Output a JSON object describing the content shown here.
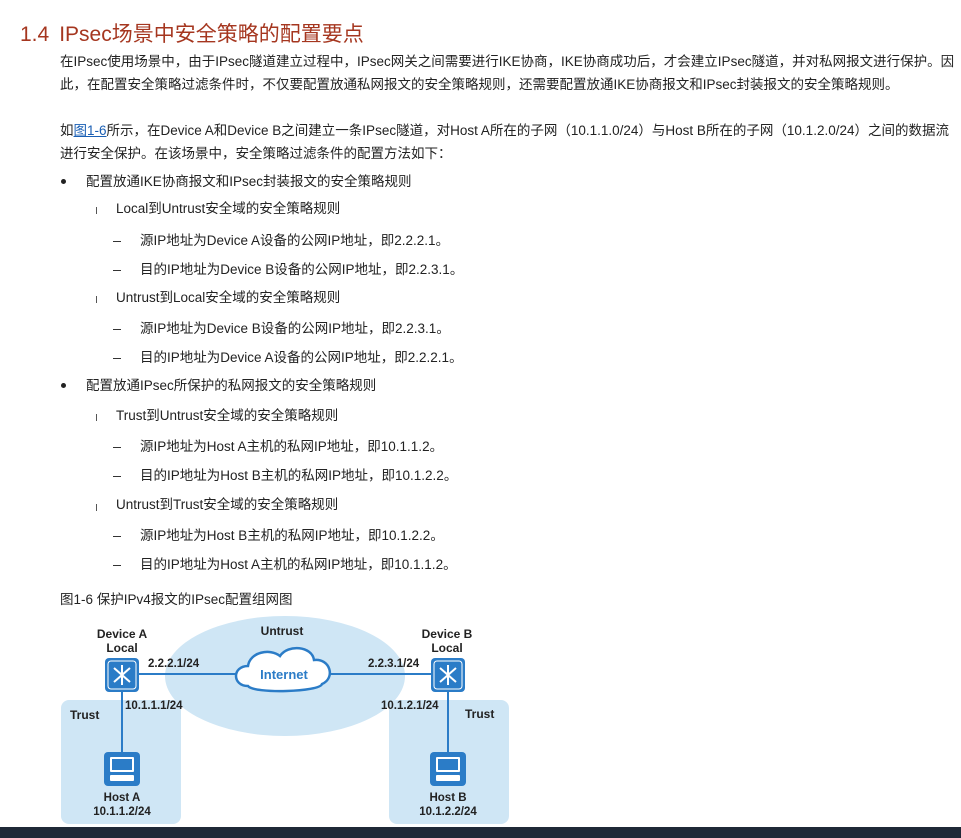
{
  "section": {
    "number": "1.4",
    "title": "IPsec场景中安全策略的配置要点"
  },
  "intro": {
    "text": "在IPsec使用场景中，由于IPsec隧道建立过程中，IPsec网关之间需要进行IKE协商，IKE协商成功后，才会建立IPsec隧道，并对私网报文进行保护。因此，在配置安全策略过滤条件时，不仅要配置放通私网报文的安全策略规则，还需要配置放通IKE协商报文和IPsec封装报文的安全策略规则。"
  },
  "para2": {
    "prefix": "如",
    "link": "图1-6",
    "rest": "所示，在Device A和Device B之间建立一条IPsec隧道，对Host A所在的子网（10.1.1.0/24）与Host B所在的子网（10.1.2.0/24）之间的数据流进行安全保护。在该场景中，安全策略过滤条件的配置方法如下："
  },
  "list": [
    {
      "label": "配置放通IKE协商报文和IPsec封装报文的安全策略规则",
      "subs": [
        {
          "label": "Local到Untrust安全域的安全策略规则",
          "items": [
            "源IP地址为Device A设备的公网IP地址，即2.2.2.1。",
            "目的IP地址为Device B设备的公网IP地址，即2.2.3.1。"
          ]
        },
        {
          "label": "Untrust到Local安全域的安全策略规则",
          "items": [
            "源IP地址为Device B设备的公网IP地址，即2.2.3.1。",
            "目的IP地址为Device A设备的公网IP地址，即2.2.2.1。"
          ]
        }
      ]
    },
    {
      "label": "配置放通IPsec所保护的私网报文的安全策略规则",
      "subs": [
        {
          "label": "Trust到Untrust安全域的安全策略规则",
          "items": [
            "源IP地址为Host A主机的私网IP地址，即10.1.1.2。",
            "目的IP地址为Host B主机的私网IP地址，即10.1.2.2。"
          ]
        },
        {
          "label": "Untrust到Trust安全域的安全策略规则",
          "items": [
            "源IP地址为Host B主机的私网IP地址，即10.1.2.2。",
            "目的IP地址为Host A主机的私网IP地址，即10.1.1.2。"
          ]
        }
      ]
    }
  ],
  "figure": {
    "caption": "图1-6 保护IPv4报文的IPsec配置组网图",
    "untrust_label": "Untrust",
    "internet_label": "Internet",
    "device_a": {
      "name": "Device A",
      "zone": "Local",
      "public_ip": "2.2.2.1/24",
      "private_ip": "10.1.1.1/24"
    },
    "device_b": {
      "name": "Device B",
      "zone": "Local",
      "public_ip": "2.2.3.1/24",
      "private_ip": "10.1.2.1/24"
    },
    "trust_left": "Trust",
    "trust_right": "Trust",
    "host_a": {
      "name": "Host A",
      "ip": "10.1.1.2/24"
    },
    "host_b": {
      "name": "Host B",
      "ip": "10.1.2.2/24"
    },
    "colors": {
      "zone_fill": "#cfe6f5",
      "device_fill": "#2b7cc7",
      "link": "#2b7cc7",
      "cloud_stroke": "#2b7cc7",
      "title": "#a5361f"
    }
  }
}
